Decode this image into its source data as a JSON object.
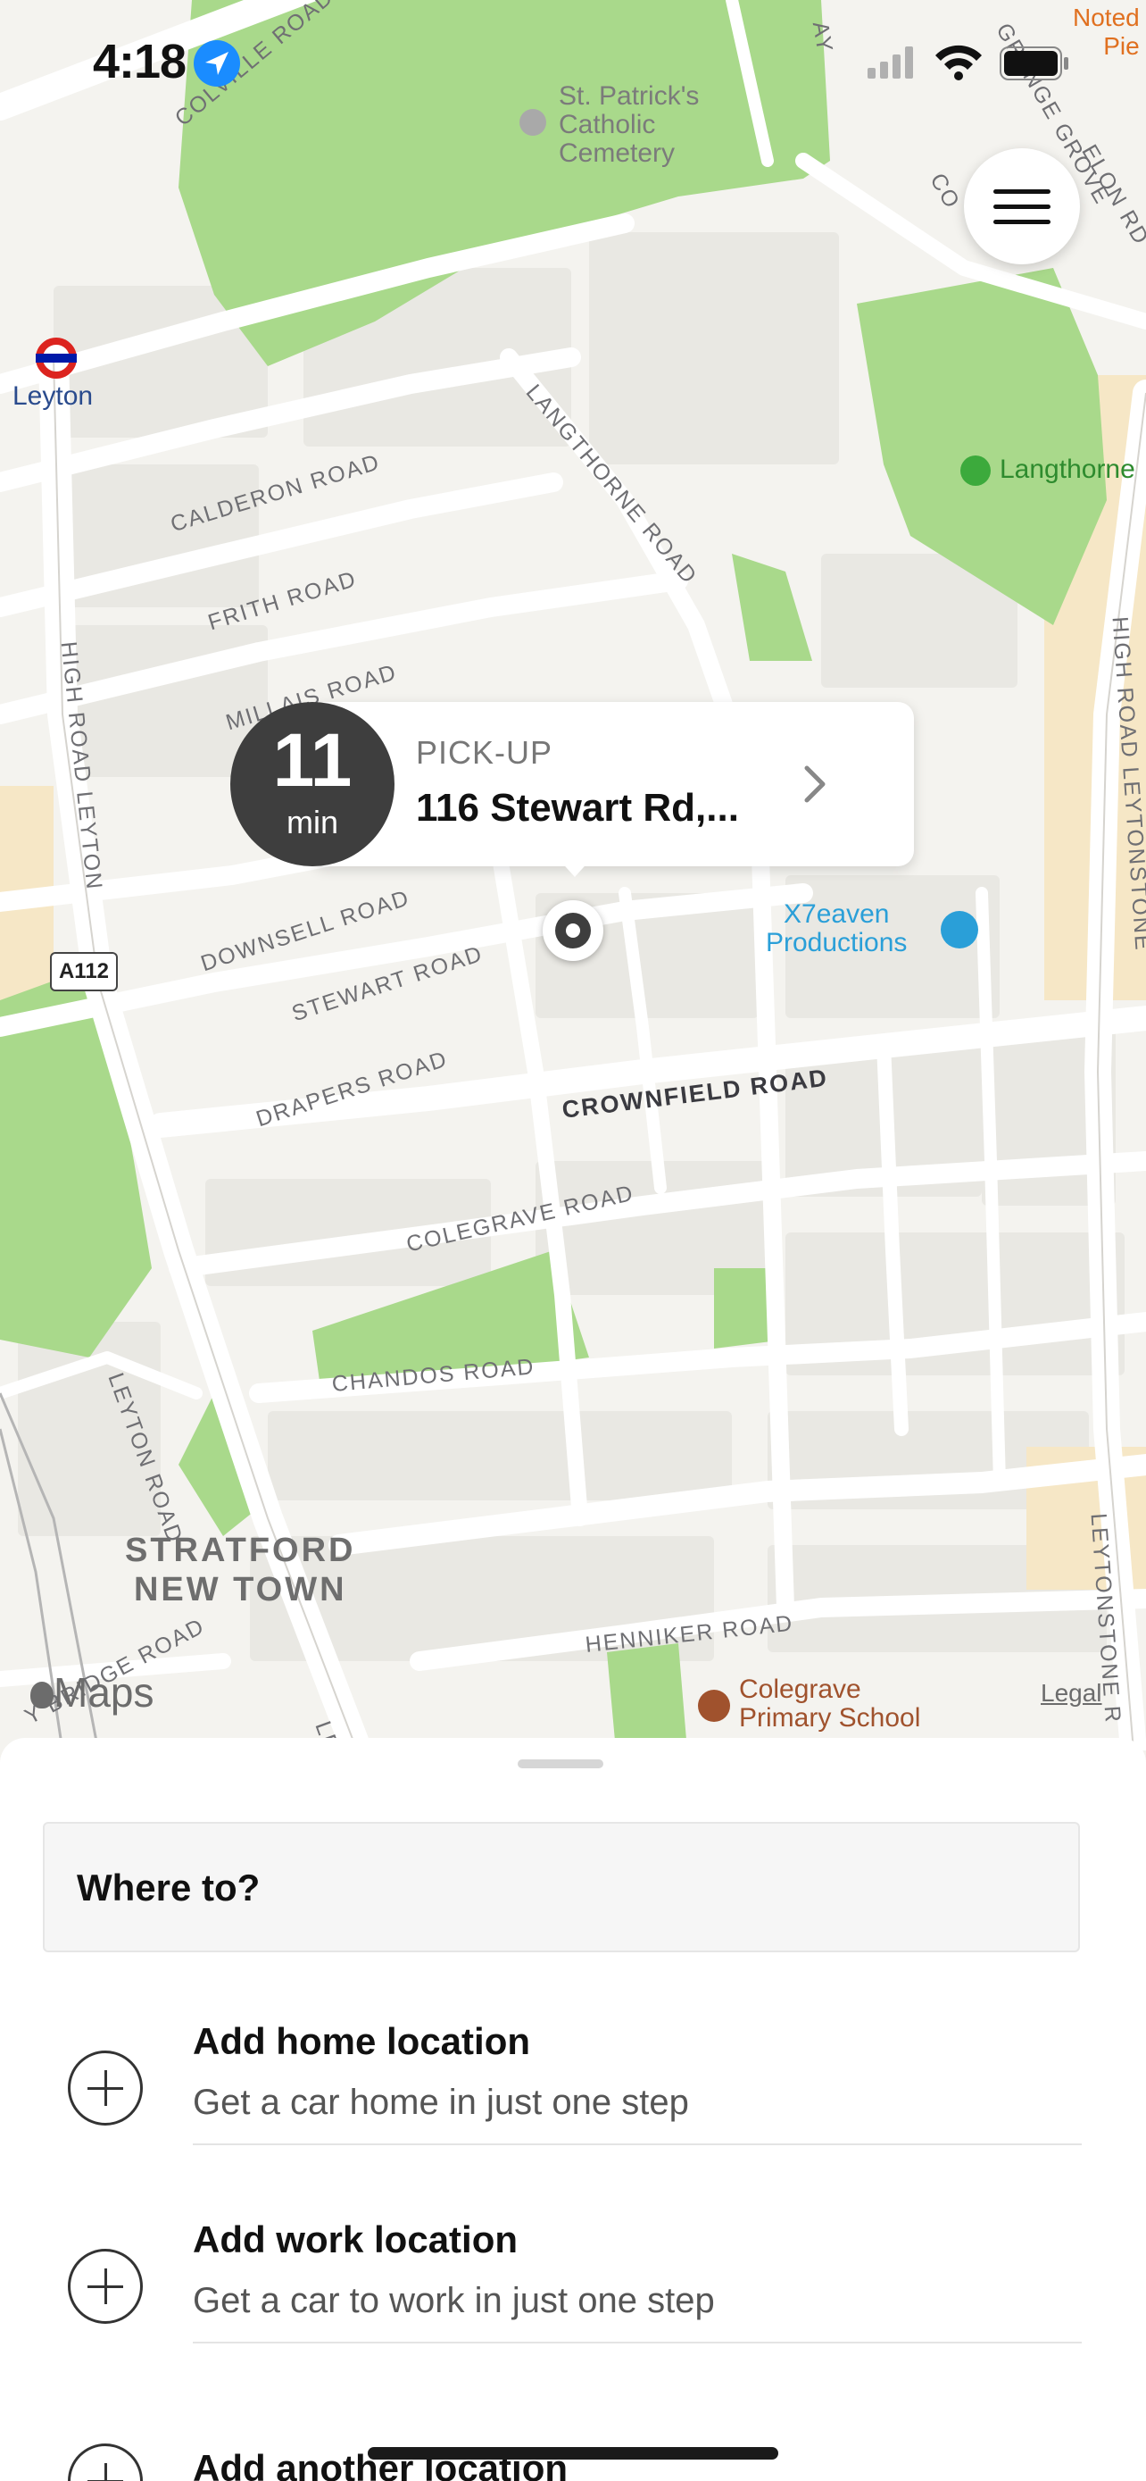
{
  "status_bar": {
    "time": "4:18"
  },
  "map": {
    "poi": {
      "cemetery": "St. Patrick's\nCatholic\nCemetery",
      "station": "Leyton",
      "park": "Langthorne",
      "venue": "X7eaven\nProductions",
      "school": "Colegrave\nPrimary School",
      "corner": "Noted\nPie"
    },
    "area": "STRATFORD\nNEW TOWN",
    "road_badge": "A112",
    "streets": {
      "colville": "Colville Road",
      "calderon": "Calderon Road",
      "frith": "Frith Road",
      "millais": "Millais Road",
      "langthorne": "Langthorne Road",
      "high_leyton": "High Road Leyton",
      "high_leytonstone": "High Road Leytonstone",
      "downsell": "Downsell Road",
      "stewart": "Stewart Road",
      "drapers": "Drapers Road",
      "crownfield": "Crownfield Road",
      "colegrave": "Colegrave Road",
      "chandos": "Chandos Road",
      "leyton_road": "Leyton Road",
      "henniker": "Henniker Road",
      "leytonstone": "Leytonstone R",
      "bridge": "y Bridge Road",
      "grove": "Grange Grove",
      "elon": "Elon Rd",
      "cor": "Co",
      "ay": "ay",
      "le": "Le"
    },
    "brand": "Maps",
    "legal": "Legal"
  },
  "pickup": {
    "eta_value": "11",
    "eta_unit": "min",
    "label": "PICK-UP",
    "address": "116 Stewart Rd,..."
  },
  "sheet": {
    "search_placeholder": "Where to?",
    "locations": [
      {
        "title": "Add home location",
        "subtitle": "Get a car home in just one step"
      },
      {
        "title": "Add work location",
        "subtitle": "Get a car to work in just one step"
      },
      {
        "title": "Add another location",
        "subtitle": ""
      }
    ]
  },
  "colors": {
    "park_green": "#a9d98b",
    "road_white": "#ffffff",
    "map_bg": "#f4f3ef",
    "block_grey": "#e8e7e3",
    "poi_blue": "#2a9fd8",
    "poi_brown": "#a0522d",
    "bubble_dark": "#3e3e3e"
  }
}
